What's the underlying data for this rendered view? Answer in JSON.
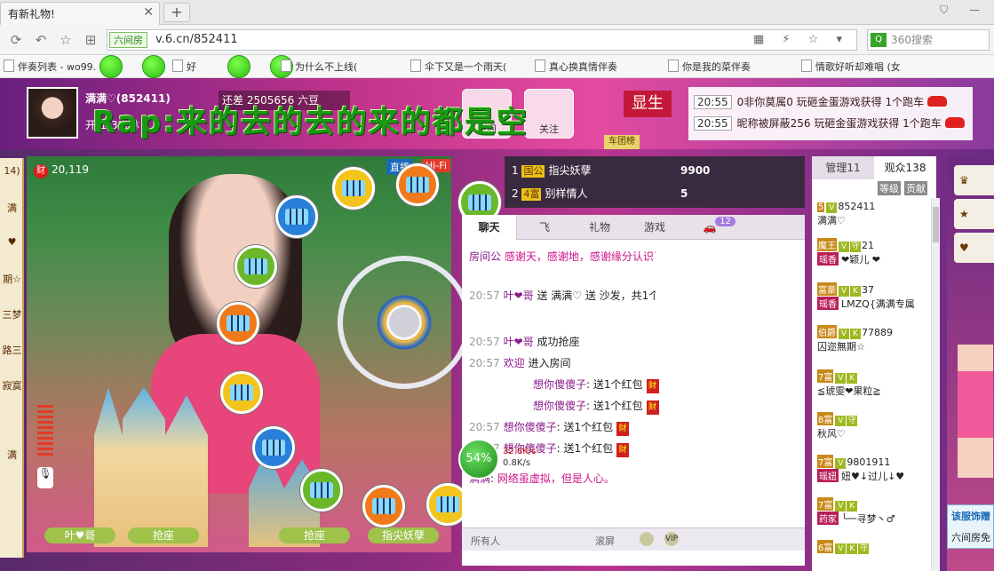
{
  "browser": {
    "tab_title": "有新礼物!",
    "new_tab": "+",
    "url_badge": "六间房",
    "url": "v.6.cn/852411",
    "search_placeholder": "360搜索",
    "bookmarks": [
      "伴奏列表 - wo99.",
      "好",
      "为什么不上线(",
      "伞下又是一个雨天(",
      "真心换真情伴奏",
      "你是我的菜伴奏",
      "情歌好听却难唱 (女"
    ]
  },
  "room": {
    "host_name": "满满♡(852411)",
    "host_sub": "开(1)3吉林",
    "beans_text": "还差 2505656 六豆",
    "btn_settings": "房间",
    "btn_profile": "关注",
    "btn_sheng": "显生",
    "btn_tuan": "车团榜",
    "overlay_text": "Rap:来的去的去的来的都是空",
    "notices": [
      {
        "time": "20:55",
        "text": "0非你莫属0 玩砸金蛋游戏获得 1个跑车"
      },
      {
        "time": "20:55",
        "text": "昵称被屏蔽256 玩砸金蛋游戏获得 1个跑车"
      }
    ]
  },
  "left_strip": [
    "14)",
    "满",
    "♥",
    "期☆",
    "三梦",
    "路三",
    "寂寞",
    "满"
  ],
  "video": {
    "wealth_icon": "财",
    "wealth_count": "20,119",
    "live_label": "直播",
    "hifi_label": "Hi-Fi",
    "seats": [
      "叶♥哥",
      "抢座",
      "抢座",
      "指尖妖孽"
    ]
  },
  "network": {
    "percent": "54%",
    "up": "32.8K/s",
    "down": "0.8K/s"
  },
  "rank": [
    {
      "pos": "1",
      "badge": "国公",
      "name": "指尖妖孽",
      "coins": "9900"
    },
    {
      "pos": "2",
      "badge": "4富",
      "name": "别样情人",
      "coins": "5"
    }
  ],
  "chat": {
    "tabs": [
      "聊天",
      "飞",
      "礼物",
      "游戏"
    ],
    "tab_badge": "12",
    "messages": [
      {
        "time": "",
        "name": "房间公",
        "text": "感谢天，感谢地，感谢缘分认识了你...XX♡ 充值请找颖儿"
      },
      {
        "time": "20:57",
        "name": "叶❤哥",
        "text": "送 满满♡ 送 沙发，共1个，感谢"
      },
      {
        "time": "20:57",
        "name": "叶❤哥",
        "text": "成功抢座"
      },
      {
        "time": "20:57",
        "name": "欢迎",
        "text": "进入房间"
      },
      {
        "time": "20:57",
        "name": "想你傻傻子",
        "text": "送1个红包"
      },
      {
        "time": "20:57",
        "name": "想你傻傻子",
        "text": "送1个红包"
      },
      {
        "time": "20:57",
        "name": "想你傻傻子",
        "text": "送1个红包"
      },
      {
        "time": "20:57",
        "name": "想你傻傻子",
        "text": "送1个红包"
      },
      {
        "time": "",
        "name": "满满",
        "text": "网络虽虚拟，但是人心。"
      }
    ],
    "redbag": "财",
    "input_who": "所有人",
    "input_scroll": "滚屏",
    "vip": "VIP"
  },
  "audience": {
    "tab_admin": "管理11",
    "tab_viewers": "观众138",
    "hdr_level": "等级",
    "hdr_contrib": "贡献",
    "users": [
      {
        "lv": "5",
        "name": "852411",
        "sub": "满满♡"
      },
      {
        "lv": "魔王",
        "name": "21",
        "sub": "❤颖儿 ❤"
      },
      {
        "lv": "富豪",
        "name": "37",
        "sub": "LMZQ{满满专属"
      },
      {
        "lv": "伯爵",
        "name": "77889",
        "sub": "囚迩無期☆"
      },
      {
        "lv": "7富",
        "name": "",
        "sub": "≦琥雯❤果粒≧"
      },
      {
        "lv": "8富",
        "name": "",
        "sub": "秋风♡"
      },
      {
        "lv": "7富",
        "name": "9801911",
        "sub": "妞♥↓过儿↓♥"
      },
      {
        "lv": "7富",
        "name": "",
        "sub": "╰一寻梦丶♂"
      },
      {
        "lv": "6富",
        "name": "",
        "sub": ""
      }
    ]
  },
  "right_panel": {
    "shop_title": "该服饰赠",
    "shop_sub": "六间房免"
  }
}
